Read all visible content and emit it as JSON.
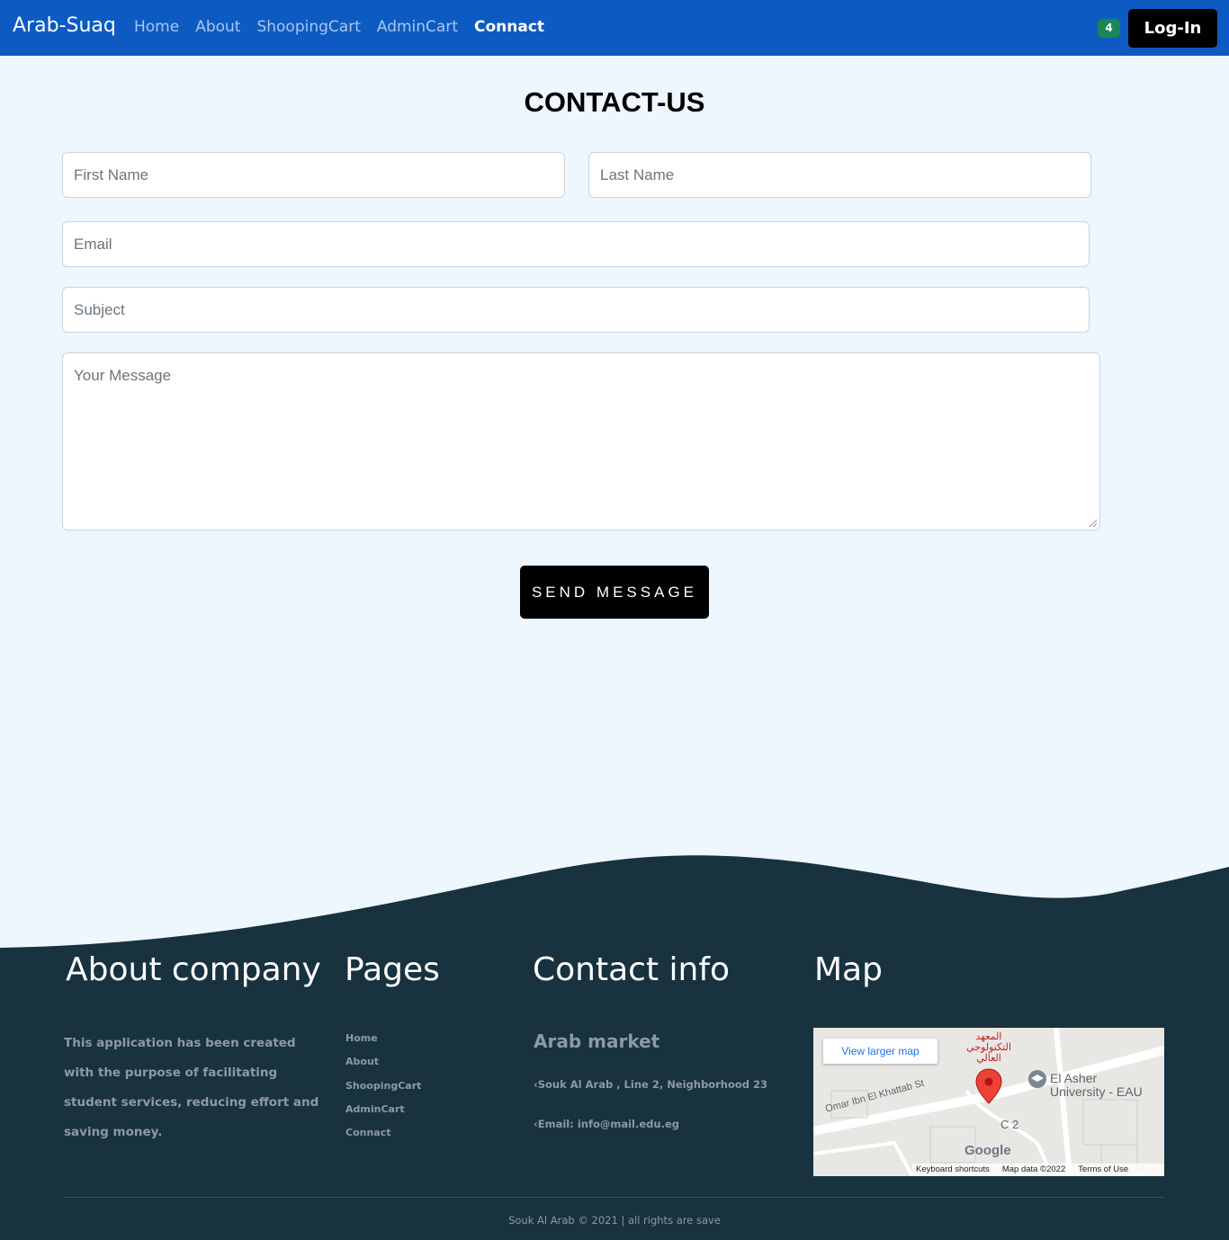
{
  "nav": {
    "brand": "Arab-Suaq",
    "links": [
      "Home",
      "About",
      "ShoopingCart",
      "AdminCart",
      "Connact"
    ],
    "cart_count": "4",
    "login_label": "Log-In"
  },
  "contact": {
    "title": "CONTACT-US",
    "first_name_placeholder": "First Name",
    "last_name_placeholder": "Last Name",
    "email_placeholder": "Email",
    "subject_placeholder": "Subject",
    "message_placeholder": "Your Message",
    "send_label": "SEND MESSAGE"
  },
  "footer": {
    "about_heading": "About company",
    "about_text": "This application has been created with the purpose of facilitating student services, reducing effort and saving money.",
    "pages_heading": "Pages",
    "pages": [
      "Home",
      "About",
      "ShoopingCart",
      "AdminCart",
      "Connact"
    ],
    "contact_heading": "Contact info",
    "market_title": "Arab market",
    "address": "Souk Al Arab , Line 2, Neighborhood 23",
    "email": "Email: info@mail.edu.eg",
    "map_heading": "Map",
    "map": {
      "larger_map": "View larger map",
      "keyboard": "Keyboard shortcuts",
      "map_data": "Map data ©2022",
      "terms": "Terms of Use",
      "street": "Omar Ibn El Khattab St",
      "university": "El Asher University - EAU",
      "institute_ar": "المعهد التكنولوجي العالي",
      "block": "C 2",
      "google": "Google"
    },
    "copyright": "Souk Al Arab © 2021 | all rights are save"
  },
  "colors": {
    "navbar": "#0d5bc2",
    "page_bg": "#eef6fe",
    "footer_bg": "#18323f",
    "badge": "#198754"
  }
}
